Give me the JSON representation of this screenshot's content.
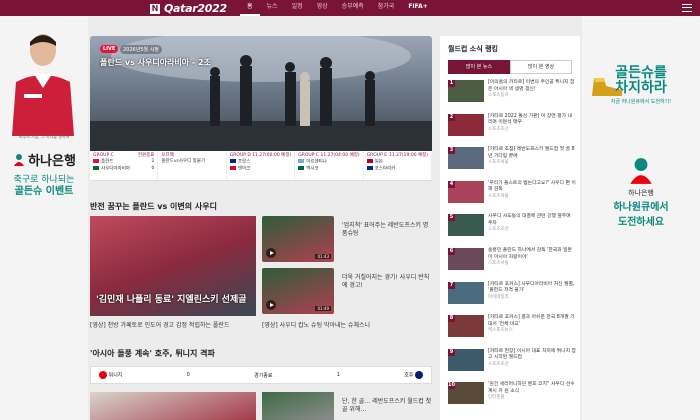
{
  "header": {
    "logo_badge": "N",
    "logo_text": "Qatar2022",
    "nav": [
      "홈",
      "뉴스",
      "일정",
      "영상",
      "승부예측",
      "참가국",
      "FIFA+"
    ]
  },
  "ad_left": {
    "caption": "포부의 기품, 그 하나를 향하여",
    "bank_name": "하나은행",
    "cta_line1": "축구로 하나되는",
    "cta_line2": "골든슈 이벤트"
  },
  "ad_right": {
    "headline_1": "골든슈를",
    "headline_2": "차지하라",
    "sub": "지금 하나원큐에서 도전하기!",
    "bank_name": "하나은행",
    "cta_line1": "하나원큐에서",
    "cta_line2": "도전하세요"
  },
  "hero": {
    "live_label": "LIVE",
    "live_meta": "2026년5월 시청",
    "title": "폴란드 vs 사우디아라비아 - 2조"
  },
  "matches": [
    {
      "group": "GROUP C",
      "status": "전원종료",
      "team1": "폴란드",
      "score1": "2",
      "team2": "사우디아라비아",
      "score2": "0",
      "c1": "#dc143c",
      "c2": "#006c35"
    },
    {
      "group": "오프팩",
      "status": "",
      "team1": "폴란드vs사우디 맞붙기",
      "score1": "",
      "team2": "",
      "score2": "",
      "c1": "#dc143c",
      "c2": "#006c35"
    },
    {
      "group": "GROUP D",
      "status": "11.27(00:00 예정)",
      "team1": "프랑스",
      "score1": "",
      "team2": "덴마크",
      "score2": "",
      "c1": "#002395",
      "c2": "#c8102e"
    },
    {
      "group": "GROUP C",
      "status": "11.27(04:00 예정)",
      "team1": "아르헨티나",
      "score1": "",
      "team2": "멕시코",
      "score2": "",
      "c1": "#74acdf",
      "c2": "#006847"
    },
    {
      "group": "GROUP E",
      "status": "11.27(19:00 예정)",
      "team1": "일본",
      "score1": "",
      "team2": "코스타리카",
      "score2": "",
      "c1": "#bc002d",
      "c2": "#002b7f"
    }
  ],
  "section1": {
    "title": "반전 꿈꾸는 폴란드 vs 이변의 사우디",
    "big_caption": "'김민재 나폴리 동료' 지엘린스키 선제골",
    "big_title": "[영상] 천방 가페토로 인도어 경고 감정 적립하는 폴란드",
    "small1_text": "'엄지척' 표어주는 레반도프스키 명품슈팅",
    "small1_src": "",
    "small1_dur": "01:43",
    "small2_text": "더욱 거칠어지는 경기! 사우디 반칙에 경고!",
    "small2_src": "",
    "small2_dur": "01:49",
    "small_title": "[영상] 사우디 캅노 슈팅 막아내는 슈체스니"
  },
  "section2": {
    "title": "'아시아 돌풍 계속' 호주, 튀니지 격파",
    "team_left": "튀니지",
    "score_left": "0",
    "status": "경기종료",
    "score_right": "1",
    "team_right": "호주",
    "bottom_text": "단, 한 골… 레반도프스키 월드컵 첫 골 위해…"
  },
  "ranking": {
    "title": "월드컵 소식 랭킹",
    "tab_active": "많이 본 뉴스",
    "tab_other": "많이 본 영상",
    "items": [
      {
        "n": "1",
        "text": "[이의흠의 카타르] 이변의 주인공 튀니지 잡은 아시아 넥 생명 갱신!",
        "src": "스포츠동아"
      },
      {
        "n": "2",
        "text": "[카타르 2022 돌싱 가판] 이 장면 평가 내리며 이분석 매우",
        "src": "스포츠조선"
      },
      {
        "n": "3",
        "text": "[카타르 초점] 레반도프스키 월드컵 첫 골 8년 기다림 끝에",
        "src": "스포츠서울"
      },
      {
        "n": "4",
        "text": "'우리가 폴스트의 범논다고요?' 사우디 편 이해 감독",
        "src": "스포츠서울"
      },
      {
        "n": "5",
        "text": "사우디 사도동의 대결에 관련 강행 앞두며 주자",
        "src": "스포츠조선"
      },
      {
        "n": "6",
        "text": "송흥민 폴란드 하나에서 감독 '한국과 일본이 아시아 자랑이야'",
        "src": "스포츠서울"
      },
      {
        "n": "7",
        "text": "[카타르 포커스] 사우디아라비아 처신 월별, '폴란드 저격 불가'",
        "src": "마이데일리"
      },
      {
        "n": "8",
        "text": "[카타르 포커스] 결과 아쉬운 한국 8개월 기대서 '전체 비교'",
        "src": "엑스포츠뉴스"
      },
      {
        "n": "9",
        "text": "[카타르 현장] 이시아 대표 처지에 튀니지 잡고 시작된 월드컵",
        "src": "스포츠조선"
      },
      {
        "n": "10",
        "text": "'원건 세리머니하던 벤포 코치'' 사우디 선수 계시 카 원 소식",
        "src": "인터풋볼"
      }
    ]
  }
}
